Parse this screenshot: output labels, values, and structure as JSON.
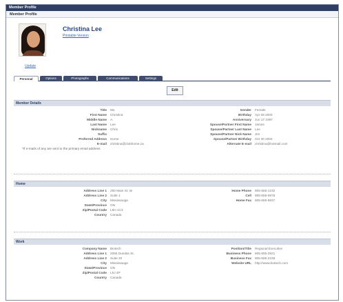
{
  "window": {
    "title": "Member Profile",
    "subtitle": "Member Profile"
  },
  "profile": {
    "name": "Christina Lee",
    "sub_link": "Printable Version",
    "update_link": "Update"
  },
  "tabs": [
    {
      "label": "Personal",
      "active": true
    },
    {
      "label": "Options",
      "active": false
    },
    {
      "label": "Photographs",
      "active": false
    },
    {
      "label": "Communications",
      "active": false
    },
    {
      "label": "Settings",
      "active": false
    }
  ],
  "edit_label": "Edit",
  "member_details": {
    "heading": "Member Details",
    "left": [
      {
        "label": "Title",
        "value": "Ms."
      },
      {
        "label": "First Name",
        "value": "Christina"
      },
      {
        "label": "Middle Name",
        "value": "A."
      },
      {
        "label": "Last Name",
        "value": "Lee"
      },
      {
        "label": "Nickname",
        "value": "Chris"
      },
      {
        "label": "Suffix",
        "value": ""
      },
      {
        "label": "Preferred Address",
        "value": "Home"
      },
      {
        "label": "E-mail",
        "value": "christina@clubhome.ca"
      }
    ],
    "right": [
      {
        "label": "Gender",
        "value": "Female"
      },
      {
        "label": "Birthday",
        "value": "Apr 08 2003"
      },
      {
        "label": "Anniversary",
        "value": "Jun 17 1997"
      },
      {
        "label": "Spouse/Partner First Name",
        "value": "James"
      },
      {
        "label": "Spouse/Partner Last Name",
        "value": "Lee"
      },
      {
        "label": "Spouse/Partner Nick Name",
        "value": "Jim"
      },
      {
        "label": "Spouse/Partner Birthday",
        "value": "Oct 30 2003"
      },
      {
        "label": "Alternate E-mail",
        "value": "christina@hotmail.com"
      }
    ],
    "note": "*If e-mails of any are sent to the primary email address"
  },
  "home": {
    "heading": "Home",
    "left": [
      {
        "label": "Address Line 1",
        "value": "250 Main St. W"
      },
      {
        "label": "Address Line 2",
        "value": "Suite 1"
      },
      {
        "label": "City",
        "value": "Mississauga"
      },
      {
        "label": "State/Province",
        "value": "ON"
      },
      {
        "label": "Zip/Postal Code",
        "value": "L5H 1C3"
      },
      {
        "label": "Country",
        "value": "Canada"
      }
    ],
    "right": [
      {
        "label": "Home Phone",
        "value": "905-555-1232"
      },
      {
        "label": "Cell",
        "value": "905-555-0878"
      },
      {
        "label": "Home Fax",
        "value": "905-555-5837"
      }
    ]
  },
  "work": {
    "heading": "Work",
    "left": [
      {
        "label": "Company Name",
        "value": "Biotech"
      },
      {
        "label": "Address Line 1",
        "value": "2055 Dundas St."
      },
      {
        "label": "Address Line 2",
        "value": "Suite 20"
      },
      {
        "label": "City",
        "value": "Mississauga"
      },
      {
        "label": "State/Province",
        "value": "ON"
      },
      {
        "label": "Zip/Postal Code",
        "value": "L5J 4P"
      },
      {
        "label": "Country",
        "value": "Canada"
      }
    ],
    "right": [
      {
        "label": "Position/Title",
        "value": "Regional Executive"
      },
      {
        "label": "Business Phone",
        "value": "905-555-2921"
      },
      {
        "label": "Business Fax",
        "value": "905-555-2239"
      },
      {
        "label": "Website URL",
        "value": "http://www.biotech.com"
      }
    ]
  }
}
